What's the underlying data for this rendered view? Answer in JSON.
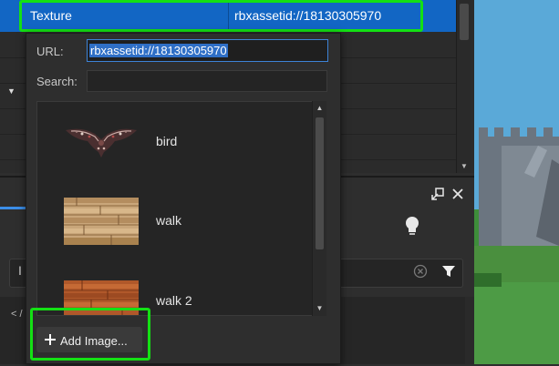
{
  "property_row": {
    "name": "Texture",
    "value": "rbxassetid://18130305970"
  },
  "asset_picker": {
    "url_label": "URL:",
    "url_value": "rbxassetid://18130305970",
    "search_label": "Search:",
    "search_value": "",
    "items": [
      {
        "label": "bird",
        "thumbnail": "bird-sprite-image"
      },
      {
        "label": "walk",
        "thumbnail": "wood-plank-sprite-image"
      },
      {
        "label": "walk 2",
        "thumbnail": "wood-plank-sprite-image"
      }
    ],
    "add_button_label": "Add Image..."
  },
  "background": {
    "side_label": "I",
    "bottom_text": "< /"
  },
  "icons": {
    "undock": "undock-icon",
    "close": "close-icon",
    "bulb": "lightbulb-icon",
    "clear": "clear-circle-icon",
    "filter": "filter-icon",
    "add": "plus-icon"
  },
  "colors": {
    "selection_blue": "#1266c4",
    "highlight_green": "#14e014",
    "panel_dark": "#2e2e2e"
  }
}
